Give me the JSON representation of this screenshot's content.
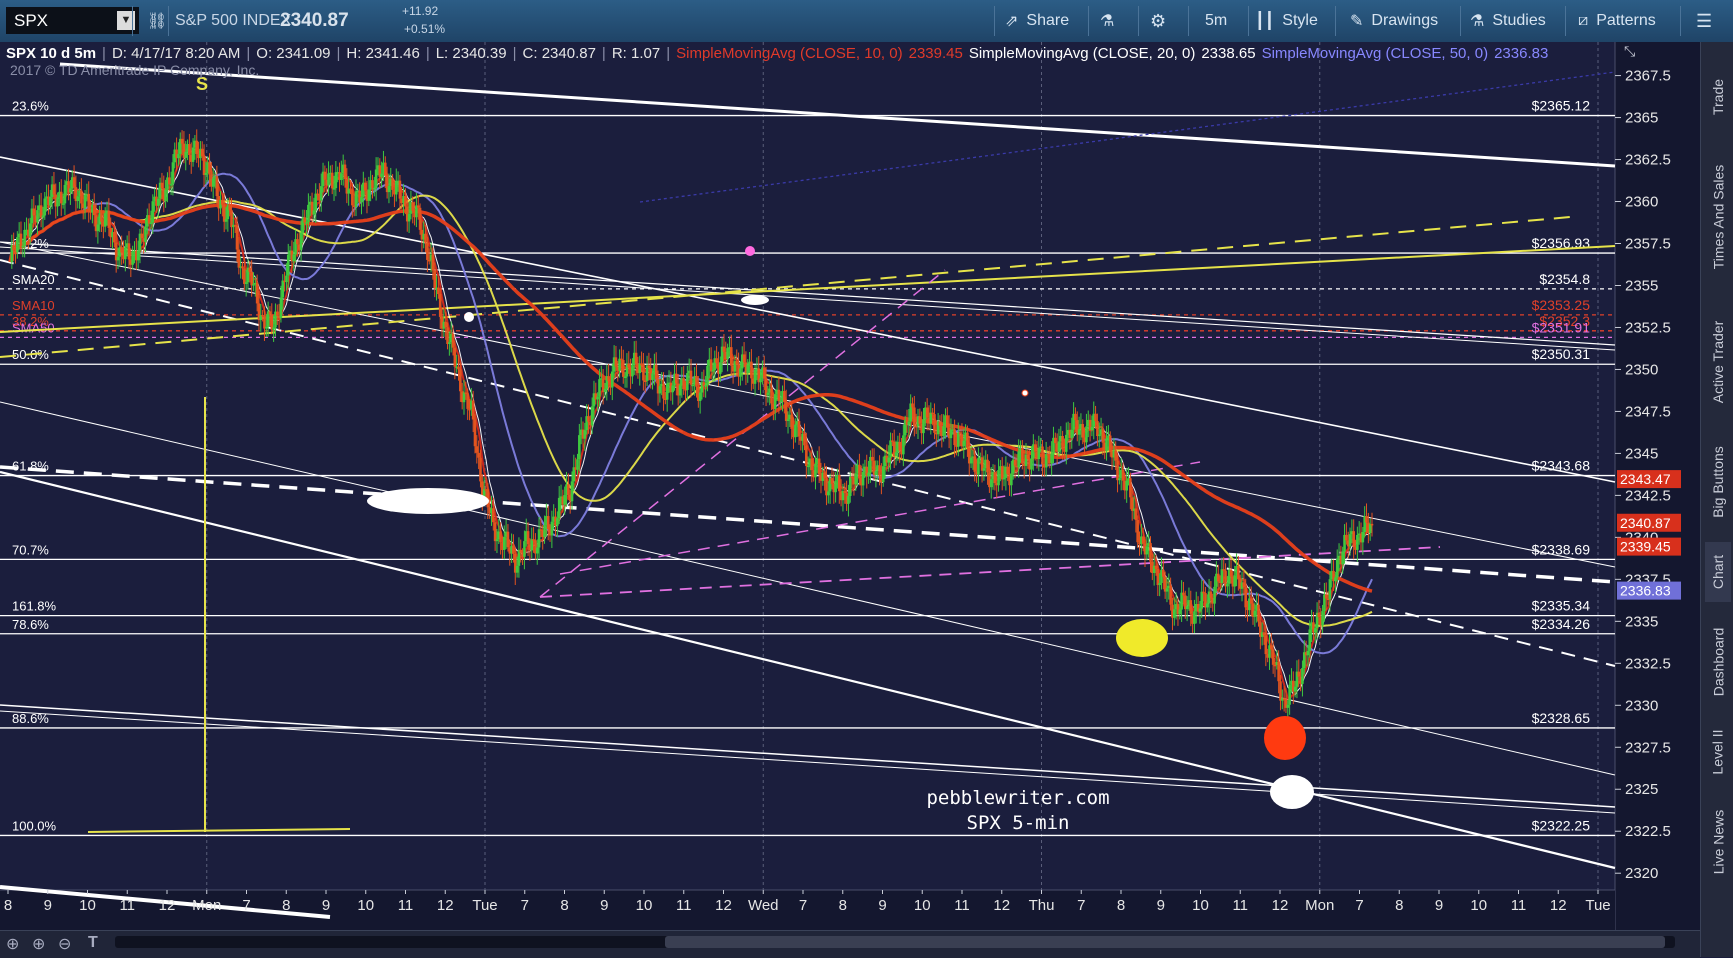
{
  "toolbar": {
    "symbol": "SPX",
    "index_name": "S&P 500 INDEX",
    "last": "2340.87",
    "change": "+11.92",
    "change_pct": "+0.51%",
    "share": "Share",
    "interval": "5m",
    "style": "Style",
    "drawings": "Drawings",
    "studies": "Studies",
    "patterns": "Patterns"
  },
  "infobar": {
    "title": "SPX 10 d 5m",
    "datetime": "D: 4/17/17 8:20 AM",
    "open": "O: 2341.09",
    "high": "H: 2341.46",
    "low": "L: 2340.39",
    "close": "C: 2340.87",
    "range": "R: 1.07",
    "sma10_label": "SimpleMovingAvg (CLOSE, 10, 0)",
    "sma10_value": "2339.45",
    "sma20_label": "SimpleMovingAvg (CLOSE, 20, 0)",
    "sma20_value": "2338.65",
    "sma50_label": "SimpleMovingAvg (CLOSE, 50, 0)",
    "sma50_value": "2336.83"
  },
  "copyright": "2017 © TD Ameritrade IP Company, Inc.",
  "watermark": [
    "pebblewriter.com",
    "SPX 5-min"
  ],
  "sidebar": [
    "Trade",
    "Times And Sales",
    "Active Trader",
    "Big Buttons",
    "Chart",
    "Dashboard",
    "Level II",
    "Live News"
  ],
  "colors": {
    "background": "#1b1e3d",
    "sma10": "#d42a1a",
    "sma20": "#ffffff",
    "sma50": "#7f7fe0",
    "sma200": "#e8401a",
    "yellow": "#e6e34a",
    "magenta": "#e070e0",
    "up": "#3ec93e",
    "down": "#e3541e"
  },
  "chart_data": {
    "type": "candlestick",
    "title": "SPX 10 d 5m",
    "ylim": [
      2319,
      2369.5
    ],
    "y_ticks": [
      2320,
      2322.5,
      2325,
      2327.5,
      2330,
      2332.5,
      2335,
      2337.5,
      2340,
      2342.5,
      2345,
      2347.5,
      2350,
      2352.5,
      2355,
      2357.5,
      2360,
      2362.5,
      2365,
      2367.5
    ],
    "x_tick_labels": [
      "8",
      "9",
      "10",
      "11",
      "12",
      "Mon",
      "7",
      "8",
      "9",
      "10",
      "11",
      "12",
      "Tue",
      "7",
      "8",
      "9",
      "10",
      "11",
      "12",
      "Wed",
      "7",
      "8",
      "9",
      "10",
      "11",
      "12",
      "Thu",
      "7",
      "8",
      "9",
      "10",
      "11",
      "12",
      "Mon",
      "7",
      "8",
      "9",
      "10",
      "11",
      "12",
      "Tue"
    ],
    "price_labels": [
      {
        "value": 2343.47,
        "text": "2343.47",
        "color": "#d8301c"
      },
      {
        "value": 2340.87,
        "text": "2340.87",
        "color": "#d8301c"
      },
      {
        "value": 2339.45,
        "text": "2339.45",
        "color": "#d8301c"
      },
      {
        "value": 2336.83,
        "text": "2336.83",
        "color": "#7070d8"
      }
    ],
    "levels": [
      {
        "value": 2365.12,
        "label": "23.6%",
        "price": "$2365.12",
        "color": "#ffffff",
        "style": "solid"
      },
      {
        "value": 2356.93,
        "label": "38.2%",
        "price": "$2356.93",
        "color": "#ffffff",
        "style": "solid"
      },
      {
        "value": 2354.8,
        "label": "SMA20",
        "price": "$2354.8",
        "color": "#ffffff",
        "style": "dotted"
      },
      {
        "value": 2353.25,
        "label": "SMA10",
        "price": "$2353.25",
        "color": "#e0402a",
        "style": "dotted"
      },
      {
        "value": 2352.3,
        "label": "38.2%",
        "price": "$2352.3",
        "color": "#e0402a",
        "style": "dotted"
      },
      {
        "value": 2351.91,
        "label": "SMA50",
        "price": "$2351.91",
        "color": "#e070e0",
        "style": "dotted"
      },
      {
        "value": 2350.31,
        "label": "50.0%",
        "price": "$2350.31",
        "color": "#ffffff",
        "style": "solid"
      },
      {
        "value": 2343.68,
        "label": "61.8%",
        "price": "$2343.68",
        "color": "#ffffff",
        "style": "solid"
      },
      {
        "value": 2338.69,
        "label": "70.7%",
        "price": "$2338.69",
        "color": "#ffffff",
        "style": "solid"
      },
      {
        "value": 2335.34,
        "label": "161.8%",
        "price": "$2335.34",
        "color": "#ffffff",
        "style": "solid"
      },
      {
        "value": 2334.26,
        "label": "78.6%",
        "price": "$2334.26",
        "color": "#ffffff",
        "style": "solid"
      },
      {
        "value": 2328.65,
        "label": "88.6%",
        "price": "$2328.65",
        "color": "#ffffff",
        "style": "solid"
      },
      {
        "value": 2322.25,
        "label": "100.0%",
        "price": "$2322.25",
        "color": "#ffffff",
        "style": "solid"
      }
    ],
    "close_series": [
      2356.4,
      2357.9,
      2358.7,
      2359.9,
      2360.2,
      2360.6,
      2360.8,
      2359.7,
      2359,
      2358.6,
      2356.7,
      2356.9,
      2357.4,
      2360,
      2360.4,
      2362.6,
      2363.3,
      2362.8,
      2362.1,
      2359.9,
      2359.3,
      2356.1,
      2355.2,
      2353,
      2352.5,
      2355.4,
      2357.5,
      2358.9,
      2360.6,
      2361.3,
      2361.7,
      2360.5,
      2360.1,
      2361.3,
      2361.7,
      2360.8,
      2359.8,
      2359.2,
      2357.3,
      2353.9,
      2351.7,
      2349.2,
      2347.3,
      2343.1,
      2340.6,
      2339.7,
      2338.7,
      2339.5,
      2339.9,
      2340.6,
      2341.7,
      2343,
      2345.8,
      2347.9,
      2349.1,
      2350,
      2350.2,
      2350.1,
      2350,
      2349.1,
      2348.7,
      2349.3,
      2349.2,
      2348.9,
      2350.3,
      2350.9,
      2350.4,
      2350,
      2349.9,
      2348.6,
      2348.3,
      2347.1,
      2345.8,
      2344.2,
      2343.5,
      2343,
      2342.6,
      2343.5,
      2344.2,
      2343.8,
      2344.9,
      2345.5,
      2347.3,
      2346.9,
      2347,
      2346.4,
      2346.2,
      2345.4,
      2344.3,
      2343.9,
      2343.4,
      2344,
      2344.6,
      2344.9,
      2344.8,
      2345.1,
      2345.9,
      2346.6,
      2346.4,
      2346.7,
      2345.3,
      2344,
      2342.4,
      2339.6,
      2338.5,
      2337.2,
      2335.8,
      2336,
      2335.6,
      2336.4,
      2337.3,
      2337.9,
      2337.2,
      2335.9,
      2334.3,
      2332.6,
      2330.2,
      2331.1,
      2333.2,
      2335.2,
      2336.5,
      2339,
      2339.8,
      2340.2,
      2340.8
    ]
  }
}
